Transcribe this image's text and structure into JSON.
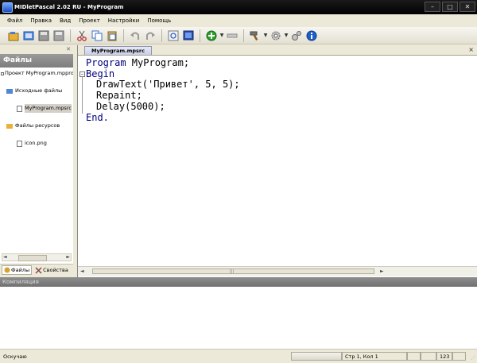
{
  "window": {
    "title": "MIDletPascal 2.02 RU - MyProgram"
  },
  "menu": [
    "Файл",
    "Правка",
    "Вид",
    "Проект",
    "Настройки",
    "Помощь"
  ],
  "toolbar_icons": [
    "open-project-icon",
    "open-file-icon",
    "save-icon",
    "save-all-icon",
    "cut-icon",
    "copy-icon",
    "paste-icon",
    "undo-icon",
    "redo-icon",
    "find-icon",
    "display-icon",
    "add-icon",
    "remove-icon",
    "build-icon",
    "settings-icon",
    "tools-icon",
    "info-icon"
  ],
  "sidebar": {
    "title": "Файлы",
    "tree": {
      "project": "Проект MyProgram.mpproj",
      "sources_folder": "Исходные файлы",
      "source_file": "MyProgram.mpsrc",
      "resources_folder": "Файлы ресурсов",
      "resource_file": "icon.png"
    },
    "tabs": {
      "files": "Файлы",
      "properties": "Свойства"
    }
  },
  "editor": {
    "tab_label": "MyProgram.mpsrc",
    "close_symbol": "×",
    "lines": {
      "line1_kw": "Program",
      "line1_rest": " MyProgram;",
      "line2_kw": "Begin",
      "line3": "DrawText('Привет', 5, 5);",
      "line4": "Repaint;",
      "line5": "Delay(5000);",
      "line6_kw": "End."
    }
  },
  "compilation": {
    "title": "Компиляция"
  },
  "status": {
    "text": "Оскучаю",
    "position": "Стр 1, Кол 1",
    "mode": "123"
  },
  "colors": {
    "keyword": "#000080",
    "selection": "#d4d0c8",
    "titlebar": "#000000"
  }
}
